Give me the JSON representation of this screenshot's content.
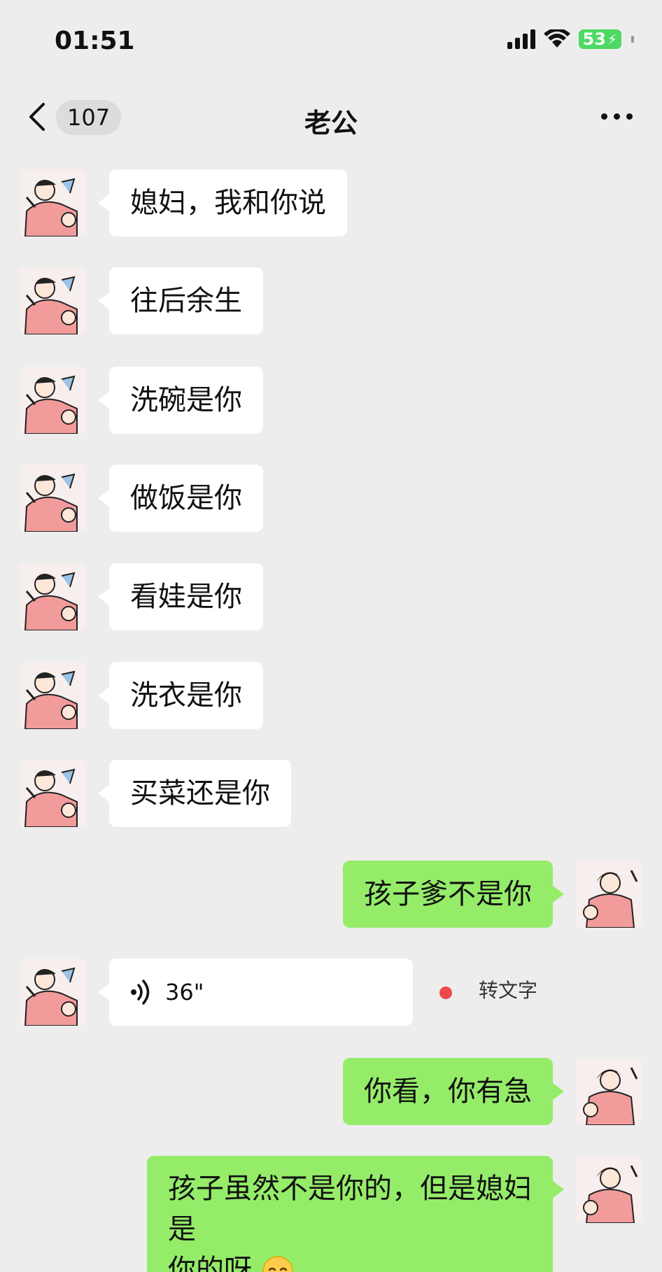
{
  "status_bar": {
    "time": "01:51",
    "battery": "53"
  },
  "nav": {
    "count": "107",
    "title": "老公"
  },
  "messages": [
    {
      "side": "left",
      "text": "媳妇，我和你说"
    },
    {
      "side": "left",
      "text": "往后余生"
    },
    {
      "side": "left",
      "text": "洗碗是你"
    },
    {
      "side": "left",
      "text": "做饭是你"
    },
    {
      "side": "left",
      "text": "看娃是你"
    },
    {
      "side": "left",
      "text": "洗衣是你"
    },
    {
      "side": "left",
      "text": "买菜还是你"
    },
    {
      "side": "right",
      "text": "孩子爹不是你"
    },
    {
      "side": "left",
      "type": "voice",
      "duration": "36\"",
      "convert_label": "转文字"
    },
    {
      "side": "right",
      "text": "你看，你有急"
    },
    {
      "side": "right",
      "text_line1": "孩子虽然不是你的，但是媳妇是",
      "text_line2": "你的呀"
    }
  ],
  "colors": {
    "background": "#ededed",
    "self_bubble": "#95ec69",
    "other_bubble": "#ffffff",
    "battery": "#4cd964"
  }
}
